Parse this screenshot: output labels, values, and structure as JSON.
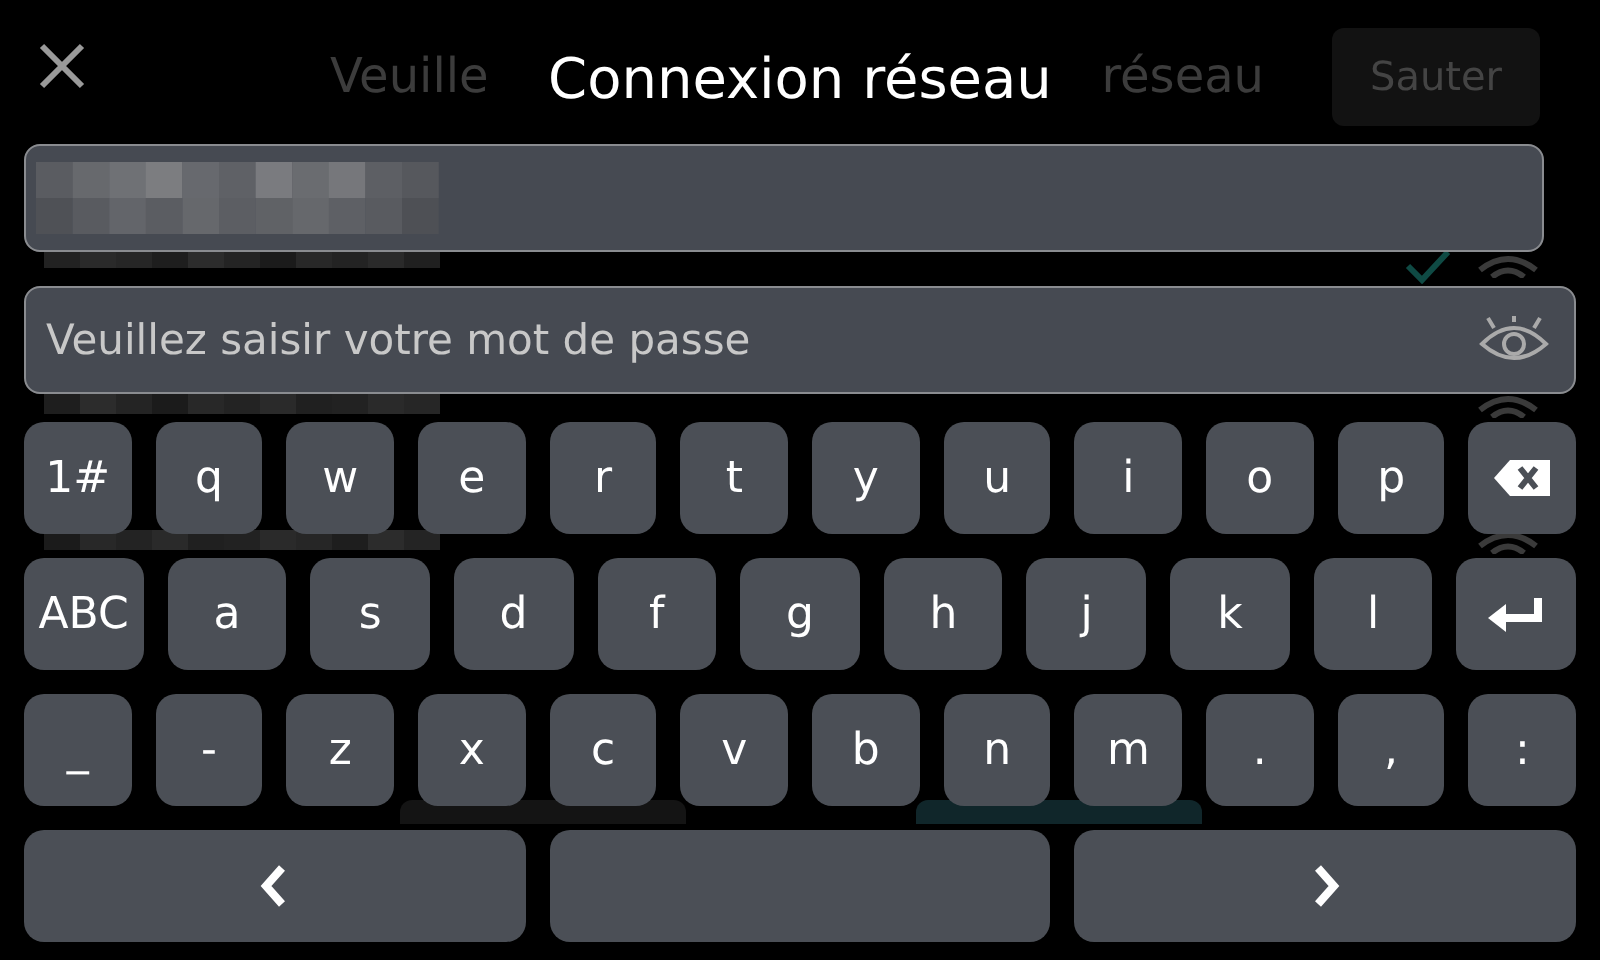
{
  "background": {
    "title_fragments": [
      "Veuille",
      "réseau"
    ],
    "skip_button": "Sauter",
    "networks": [
      {
        "connected": true
      },
      {
        "connected": false
      },
      {
        "connected": false
      }
    ]
  },
  "dialog": {
    "title": "Connexion réseau",
    "password_field": {
      "placeholder": "Veuillez saisir votre mot de passe"
    }
  },
  "keyboard": {
    "rows": [
      [
        {
          "kind": "char",
          "label": "1#"
        },
        {
          "kind": "char",
          "label": "q"
        },
        {
          "kind": "char",
          "label": "w"
        },
        {
          "kind": "char",
          "label": "e"
        },
        {
          "kind": "char",
          "label": "r"
        },
        {
          "kind": "char",
          "label": "t"
        },
        {
          "kind": "char",
          "label": "y"
        },
        {
          "kind": "char",
          "label": "u"
        },
        {
          "kind": "char",
          "label": "i"
        },
        {
          "kind": "char",
          "label": "o"
        },
        {
          "kind": "char",
          "label": "p"
        },
        {
          "kind": "backspace"
        }
      ],
      [
        {
          "kind": "char",
          "label": "ABC"
        },
        {
          "kind": "char",
          "label": "a"
        },
        {
          "kind": "char",
          "label": "s"
        },
        {
          "kind": "char",
          "label": "d"
        },
        {
          "kind": "char",
          "label": "f"
        },
        {
          "kind": "char",
          "label": "g"
        },
        {
          "kind": "char",
          "label": "h"
        },
        {
          "kind": "char",
          "label": "j"
        },
        {
          "kind": "char",
          "label": "k"
        },
        {
          "kind": "char",
          "label": "l"
        },
        {
          "kind": "enter"
        }
      ],
      [
        {
          "kind": "char",
          "label": "_"
        },
        {
          "kind": "char",
          "label": "-"
        },
        {
          "kind": "char",
          "label": "z"
        },
        {
          "kind": "char",
          "label": "x"
        },
        {
          "kind": "char",
          "label": "c"
        },
        {
          "kind": "char",
          "label": "v"
        },
        {
          "kind": "char",
          "label": "b"
        },
        {
          "kind": "char",
          "label": "n"
        },
        {
          "kind": "char",
          "label": "m"
        },
        {
          "kind": "char",
          "label": "."
        },
        {
          "kind": "char",
          "label": ","
        },
        {
          "kind": "char",
          "label": ":"
        }
      ],
      [
        {
          "kind": "left"
        },
        {
          "kind": "space"
        },
        {
          "kind": "right"
        }
      ]
    ]
  }
}
